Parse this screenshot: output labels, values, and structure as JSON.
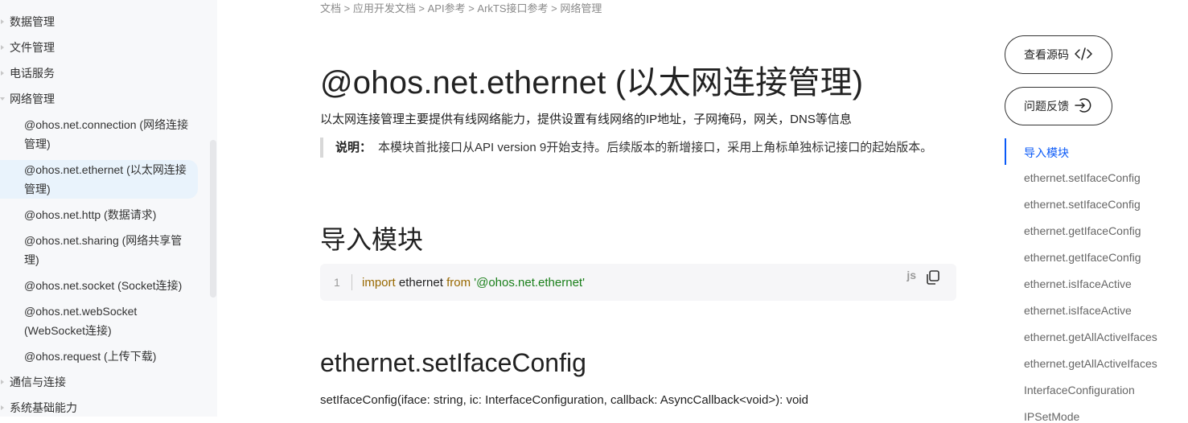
{
  "sidebar": {
    "top_items": [
      {
        "label": "数据管理"
      },
      {
        "label": "文件管理"
      },
      {
        "label": "电话服务"
      },
      {
        "label": "网络管理"
      }
    ],
    "sub_items": [
      {
        "line1": "@ohos.net.connection (网络连接",
        "line2": "管理)"
      },
      {
        "line1": "@ohos.net.ethernet (以太网连接",
        "line2": "管理)"
      },
      {
        "line1": "@ohos.net.http (数据请求)"
      },
      {
        "line1": "@ohos.net.sharing (网络共享管",
        "line2": "理)"
      },
      {
        "line1": "@ohos.net.socket (Socket连接)"
      },
      {
        "line1": "@ohos.net.webSocket",
        "line2": "(WebSocket连接)"
      },
      {
        "line1": "@ohos.request (上传下载)"
      }
    ],
    "bottom_items": [
      {
        "label": "通信与连接"
      },
      {
        "label": "系统基础能力"
      }
    ]
  },
  "breadcrumb": "文档 > 应用开发文档 > API参考 > ArkTS接口参考 > 网络管理",
  "page_title": "@ohos.net.ethernet (以太网连接管理)",
  "intro": "以太网连接管理主要提供有线网络能力，提供设置有线网络的IP地址，子网掩码，网关，DNS等信息",
  "note": {
    "label": "说明：",
    "text": "本模块首批接口从API version 9开始支持。后续版本的新增接口，采用上角标单独标记接口的起始版本。"
  },
  "section_import": "导入模块",
  "code": {
    "line_number": "1",
    "kw_import": "import",
    "name": " ethernet ",
    "kw_from": "from",
    "module": " '@ohos.net.ethernet'",
    "lang": "js"
  },
  "section_setiface": "ethernet.setIfaceConfig",
  "signature": "setIfaceConfig(iface: string, ic: InterfaceConfiguration, callback: AsyncCallback<void>): void",
  "actions": {
    "view_source": "查看源码",
    "feedback": "问题反馈"
  },
  "toc": [
    "导入模块",
    "ethernet.setIfaceConfig",
    "ethernet.setIfaceConfig",
    "ethernet.getIfaceConfig",
    "ethernet.getIfaceConfig",
    "ethernet.isIfaceActive",
    "ethernet.isIfaceActive",
    "ethernet.getAllActiveIfaces",
    "ethernet.getAllActiveIfaces",
    "InterfaceConfiguration",
    "IPSetMode"
  ],
  "colors": {
    "accent": "#0a59f7",
    "sidebar_bg": "#f7f8fa",
    "active_bg": "#e9f3fc"
  }
}
